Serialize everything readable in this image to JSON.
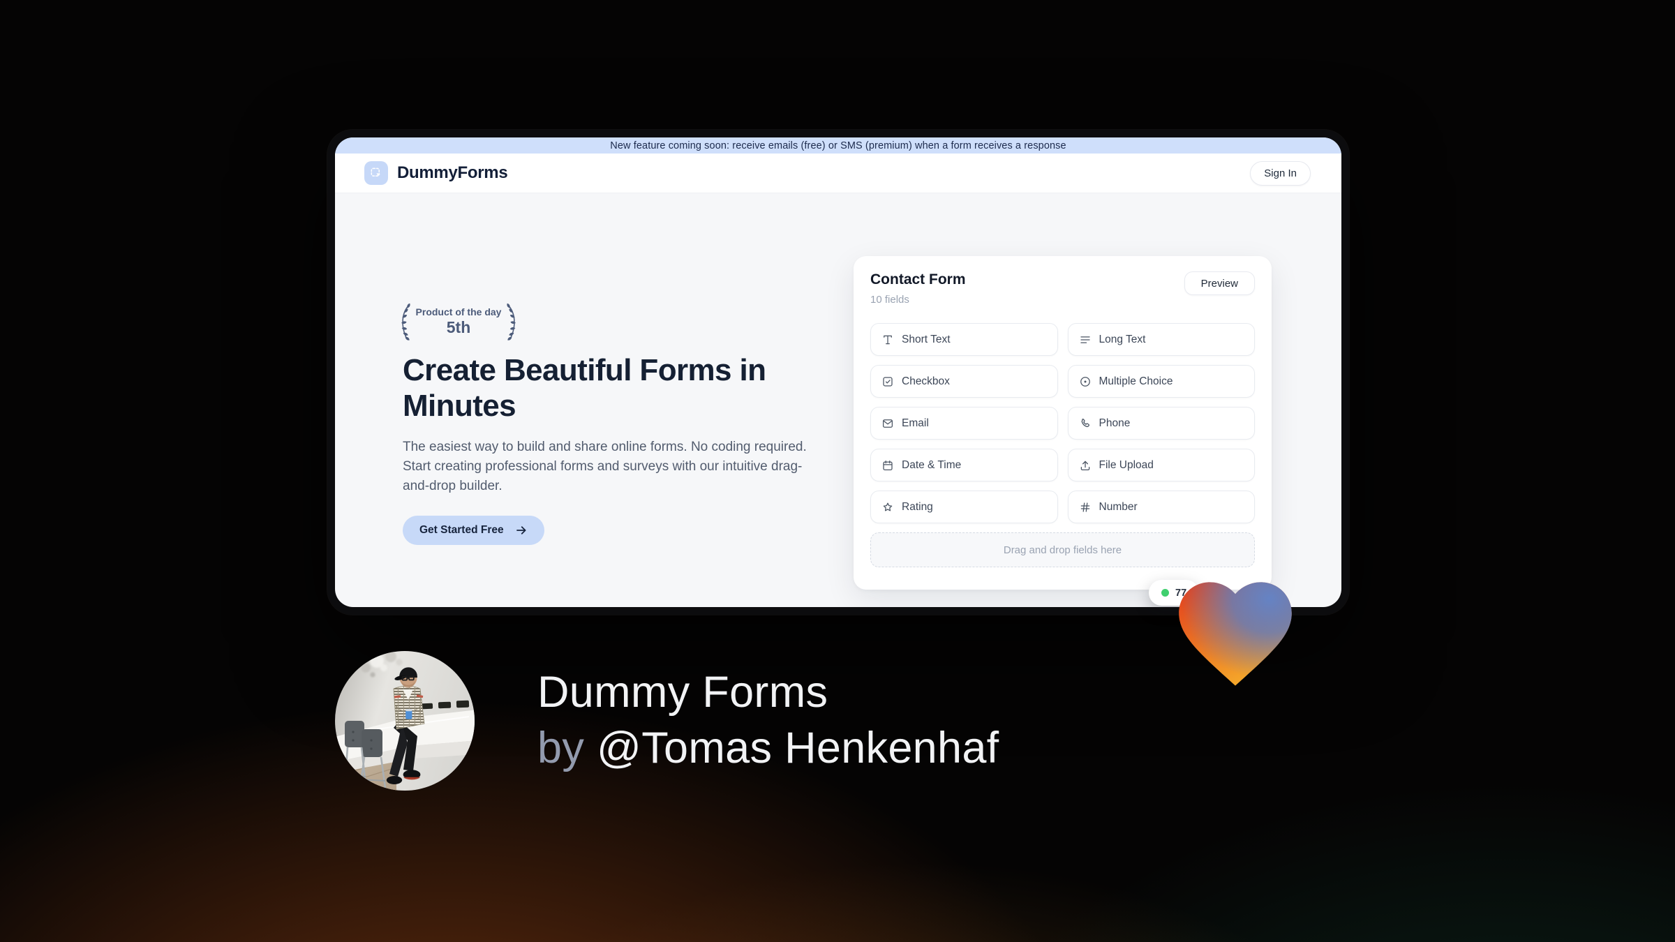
{
  "banner": {
    "text": "New feature coming soon: receive emails (free) or SMS (premium) when a form receives a response"
  },
  "header": {
    "brand": "DummyForms",
    "sign_in_label": "Sign In"
  },
  "hero": {
    "award_line1": "Product of the day",
    "award_line2": "5th",
    "title": "Create Beautiful Forms in Minutes",
    "description": "The easiest way to build and share online forms. No coding required. Start creating professional forms and surveys with our intuitive drag-and-drop builder.",
    "cta_label": "Get Started Free"
  },
  "form_card": {
    "title": "Contact Form",
    "field_count": "10 fields",
    "preview_label": "Preview",
    "fields": [
      {
        "label": "Short Text",
        "icon": "type-icon"
      },
      {
        "label": "Long Text",
        "icon": "align-left-icon"
      },
      {
        "label": "Checkbox",
        "icon": "checkbox-icon"
      },
      {
        "label": "Multiple Choice",
        "icon": "radio-icon"
      },
      {
        "label": "Email",
        "icon": "mail-icon"
      },
      {
        "label": "Phone",
        "icon": "phone-icon"
      },
      {
        "label": "Date & Time",
        "icon": "calendar-icon"
      },
      {
        "label": "File Upload",
        "icon": "upload-icon"
      },
      {
        "label": "Rating",
        "icon": "star-icon"
      },
      {
        "label": "Number",
        "icon": "hash-icon"
      }
    ],
    "dropzone_text": "Drag and drop fields here",
    "response_badge": "77"
  },
  "footer_overlay": {
    "title": "Dummy Forms",
    "byline_prefix": "by",
    "byline_handle": "@Tomas Henkenhaf"
  },
  "colors": {
    "banner_blue": "#cfdffb",
    "accent_light_blue": "#c7d9f8",
    "navy": "#152033",
    "heart_red": "#e23a1c",
    "heart_orange": "#f5a62a",
    "heart_blue": "#5d7ec2",
    "badge_green": "#3fcf6e"
  }
}
